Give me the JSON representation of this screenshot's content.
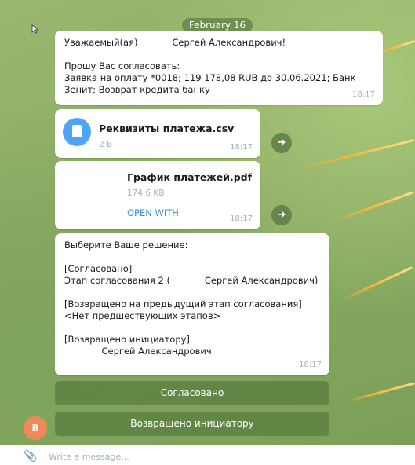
{
  "date_separator": "February 16",
  "message1": {
    "lines": [
      "Уважаемый(ая)            Сергей Александрович!",
      "",
      "Прошу Вас согласовать:",
      "Заявка на оплату *0018; 119 178,08 RUB до 30.06.2021; Банк",
      "Зенит; Возврат кредита банку"
    ],
    "time": "18:17"
  },
  "file1": {
    "name": "Реквизиты платежа.csv",
    "size": "2 B",
    "time": "18:17"
  },
  "file2": {
    "name": "График платежей.pdf",
    "size": "174.6 KB",
    "action": "OPEN WITH",
    "time": "18:17"
  },
  "message2": {
    "lines": [
      "Выберите Ваше решение:",
      "",
      "[Согласовано]",
      "Этап согласования 2 (            Сергей Александрович)",
      "",
      "[Возвращено на предыдущий этап согласования]",
      "<Нет предшествующих этапов>",
      "",
      "[Возвращено инициатору]",
      "             Сергей Александрович"
    ],
    "time": "18:17"
  },
  "keyboard": {
    "approve": "Согласовано",
    "return_initiator": "Возвращено инициатору"
  },
  "avatar_letter": "B",
  "composer": {
    "placeholder": "Write a message..."
  },
  "colors": {
    "accent_link": "#3a8fd6",
    "file_icon": "#4ea4f6",
    "avatar": "#f0895a",
    "keyboard_button": "#5c8041"
  }
}
